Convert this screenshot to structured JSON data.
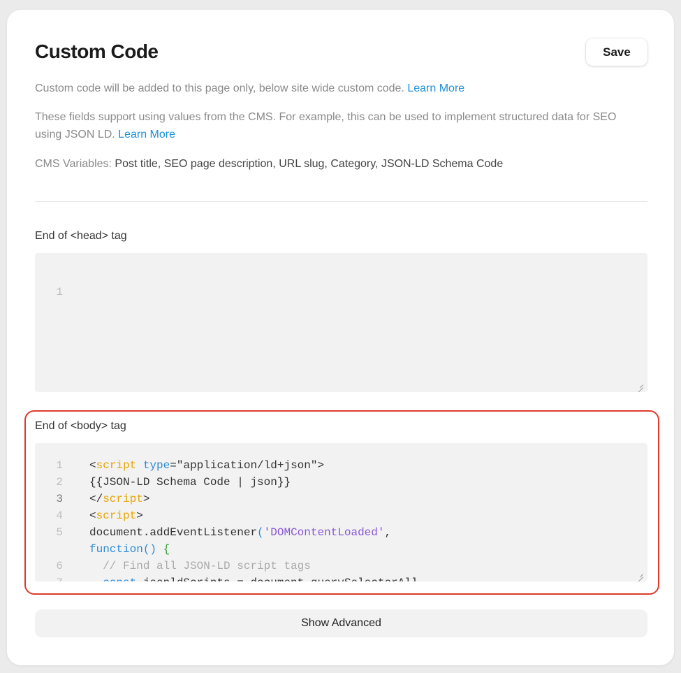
{
  "panel": {
    "title": "Custom Code",
    "save_label": "Save"
  },
  "description": {
    "line1_text": "Custom code will be added to this page only, below site wide custom code.",
    "line1_link": "Learn More",
    "line2_text": "These fields support using values from the CMS. For example, this can be used to implement structured data for SEO using JSON LD.",
    "line2_link": "Learn More",
    "vars_label": "CMS Variables:",
    "vars_value": "Post title, SEO page description, URL slug, Category, JSON-LD Schema Code"
  },
  "head_section": {
    "label": "End of <head> tag",
    "line_numbers": [
      "1"
    ]
  },
  "body_section": {
    "label": "End of <body> tag",
    "active_line": "3",
    "lines": [
      {
        "num": "1",
        "parts": [
          [
            "t",
            "<"
          ],
          [
            "tag",
            "script"
          ],
          [
            "t",
            " "
          ],
          [
            "attr",
            "type"
          ],
          [
            "t",
            "=\"application/ld+json\">"
          ]
        ]
      },
      {
        "num": "2",
        "parts": [
          [
            "t",
            "{{JSON-LD Schema Code | json}}"
          ]
        ]
      },
      {
        "num": "3",
        "parts": [
          [
            "t",
            "</"
          ],
          [
            "tag",
            "script"
          ],
          [
            "t",
            ">"
          ]
        ]
      },
      {
        "num": "4",
        "parts": [
          [
            "t",
            "<"
          ],
          [
            "tag",
            "script"
          ],
          [
            "t",
            ">"
          ]
        ]
      },
      {
        "num": "5",
        "parts": [
          [
            "t",
            "document.addEventListener"
          ],
          [
            "paren",
            "("
          ],
          [
            "str",
            "'DOMContentLoaded'"
          ],
          [
            "t",
            ","
          ]
        ]
      },
      {
        "num": "",
        "parts": [
          [
            "kw",
            "function"
          ],
          [
            "paren",
            "()"
          ],
          [
            "t",
            " "
          ],
          [
            "brace",
            "{"
          ]
        ]
      },
      {
        "num": "6",
        "parts": [
          [
            "t",
            "  "
          ],
          [
            "cmt",
            "// Find all JSON-LD script tags"
          ]
        ]
      },
      {
        "num": "7",
        "parts": [
          [
            "t",
            "  "
          ],
          [
            "kw",
            "const"
          ],
          [
            "t",
            " jsonldScripts = document.querySelectorAll"
          ]
        ]
      }
    ]
  },
  "advanced_label": "Show Advanced",
  "colors": {
    "link": "#1a8fd6",
    "highlight_border": "#e03a2a",
    "code_tag": "#e8a400",
    "code_keyword": "#2b8ad6",
    "code_string": "#8a56d6"
  }
}
